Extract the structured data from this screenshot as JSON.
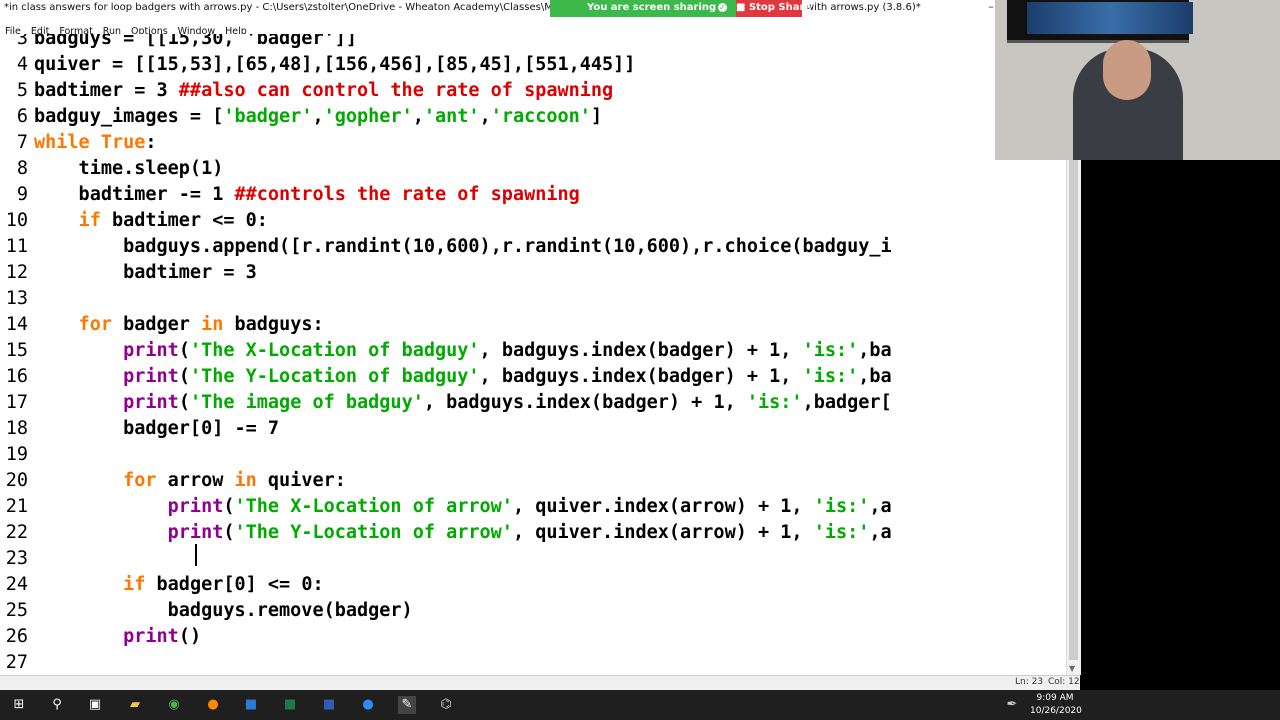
{
  "window": {
    "title": "*in class answers for loop badgers with arrows.py - C:\\Users\\zstolter\\OneDrive - Wheaton Academy\\Classes\\MASTER _ Intro to P",
    "title_suffix": "with arrows.py (3.8.6)*",
    "minimize_glyph": "–"
  },
  "share_banner": {
    "text": "You are screen sharing",
    "stop_label": "Stop Share"
  },
  "menu": [
    "File",
    "Edit",
    "Format",
    "Run",
    "Options",
    "Window",
    "Help"
  ],
  "editor": {
    "lines": [
      {
        "n": "3",
        "html": "<span class=\"t\">badguys = [[15,30, 'badger']]</span>"
      },
      {
        "n": "4",
        "html": "<span class=\"t\">quiver = [[15,53],[65,48],[156,456],[85,45],[551,445]]</span>"
      },
      {
        "n": "5",
        "html": "<span class=\"t\">badtimer = 3 </span><span class=\"c\">##also can control the rate of spawning</span>"
      },
      {
        "n": "6",
        "html": "<span class=\"t\">badguy_images = [</span><span class=\"s\">'badger'</span><span class=\"t\">,</span><span class=\"s\">'gopher'</span><span class=\"t\">,</span><span class=\"s\">'ant'</span><span class=\"t\">,</span><span class=\"s\">'raccoon'</span><span class=\"t\">]</span>"
      },
      {
        "n": "7",
        "html": "<span class=\"k\">while</span><span class=\"t\"> </span><span class=\"k\">True</span><span class=\"t\">:</span>"
      },
      {
        "n": "8",
        "html": "<span class=\"t\">    time.sleep(1)</span>"
      },
      {
        "n": "9",
        "html": "<span class=\"t\">    badtimer -= 1 </span><span class=\"c\">##controls the rate of spawning</span>"
      },
      {
        "n": "10",
        "html": "<span class=\"t\">    </span><span class=\"k\">if</span><span class=\"t\"> badtimer &lt;= 0:</span>"
      },
      {
        "n": "11",
        "html": "<span class=\"t\">        badguys.append([r.randint(10,600),r.randint(10,600),r.choice(badguy_i</span>"
      },
      {
        "n": "12",
        "html": "<span class=\"t\">        badtimer = 3</span>"
      },
      {
        "n": "13",
        "html": ""
      },
      {
        "n": "14",
        "html": "<span class=\"t\">    </span><span class=\"k\">for</span><span class=\"t\"> badger </span><span class=\"k\">in</span><span class=\"t\"> badguys:</span>"
      },
      {
        "n": "15",
        "html": "<span class=\"t\">        </span><span class=\"b\">print</span><span class=\"t\">(</span><span class=\"s\">'The X-Location of badguy'</span><span class=\"t\">, badguys.index(badger) + 1, </span><span class=\"s\">'is:'</span><span class=\"t\">,ba</span>"
      },
      {
        "n": "16",
        "html": "<span class=\"t\">        </span><span class=\"b\">print</span><span class=\"t\">(</span><span class=\"s\">'The Y-Location of badguy'</span><span class=\"t\">, badguys.index(badger) + 1, </span><span class=\"s\">'is:'</span><span class=\"t\">,ba</span>"
      },
      {
        "n": "17",
        "html": "<span class=\"t\">        </span><span class=\"b\">print</span><span class=\"t\">(</span><span class=\"s\">'The image of badguy'</span><span class=\"t\">, badguys.index(badger) + 1, </span><span class=\"s\">'is:'</span><span class=\"t\">,badger[</span>"
      },
      {
        "n": "18",
        "html": "<span class=\"t\">        badger[0] -= 7</span>"
      },
      {
        "n": "19",
        "html": ""
      },
      {
        "n": "20",
        "html": "<span class=\"t\">        </span><span class=\"k\">for</span><span class=\"t\"> arrow </span><span class=\"k\">in</span><span class=\"t\"> quiver:</span>"
      },
      {
        "n": "21",
        "html": "<span class=\"t\">            </span><span class=\"b\">print</span><span class=\"t\">(</span><span class=\"s\">'The X-Location of arrow'</span><span class=\"t\">, quiver.index(arrow) + 1, </span><span class=\"s\">'is:'</span><span class=\"t\">,a</span>"
      },
      {
        "n": "22",
        "html": "<span class=\"t\">            </span><span class=\"b\">print</span><span class=\"t\">(</span><span class=\"s\">'The Y-Location of arrow'</span><span class=\"t\">, quiver.index(arrow) + 1, </span><span class=\"s\">'is:'</span><span class=\"t\">,a</span>"
      },
      {
        "n": "23",
        "html": ""
      },
      {
        "n": "24",
        "html": "<span class=\"t\">        </span><span class=\"k\">if</span><span class=\"t\"> badger[0] &lt;= 0:</span>"
      },
      {
        "n": "25",
        "html": "<span class=\"t\">            badguys.remove(badger)</span>"
      },
      {
        "n": "26",
        "html": "<span class=\"t\">        </span><span class=\"b\">print</span><span class=\"t\">()</span>"
      },
      {
        "n": "27",
        "html": ""
      }
    ]
  },
  "status": {
    "line": "Ln: 23",
    "col": "Col: 12"
  },
  "taskbar": {
    "icons": [
      "windows-start-icon",
      "search-icon",
      "task-view-icon",
      "file-explorer-icon",
      "chrome-icon",
      "firefox-icon",
      "outlook-icon",
      "excel-icon",
      "word-icon",
      "zoom-icon",
      "idle-icon",
      "python-icon"
    ],
    "time": "9:09 AM",
    "date": "10/26/2020"
  },
  "colors": {
    "keyword": "#ff7700",
    "builtin": "#900090",
    "string": "#00aa00",
    "comment": "#dd0000",
    "share_green": "#3cb94a",
    "stop_red": "#e0383e"
  }
}
